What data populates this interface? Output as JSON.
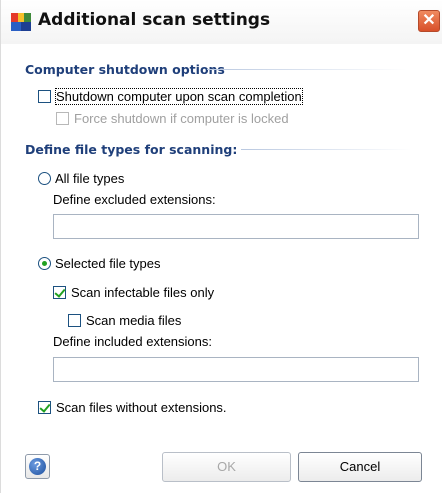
{
  "window": {
    "title": "Additional scan settings",
    "app_icon": "avg-logo-icon",
    "close_glyph": "✕"
  },
  "shutdown_section": {
    "heading": "Computer shutdown options",
    "shutdown_checkbox": {
      "label": "Shutdown computer upon scan completion",
      "checked": false
    },
    "force_checkbox": {
      "label": "Force shutdown if computer is locked",
      "checked": false,
      "disabled": true
    }
  },
  "filetypes_section": {
    "heading": "Define file types for scanning:",
    "all_types_radio": {
      "label": "All file types",
      "selected": false
    },
    "excluded_caption": "Define excluded extensions:",
    "excluded_value": "",
    "selected_types_radio": {
      "label": "Selected file types",
      "selected": true
    },
    "infectable_checkbox": {
      "label": "Scan infectable files only",
      "checked": true
    },
    "media_checkbox": {
      "label": "Scan media files",
      "checked": false
    },
    "included_caption": "Define included extensions:",
    "included_value": "",
    "no_ext_checkbox": {
      "label": "Scan files without extensions.",
      "checked": true
    }
  },
  "footer": {
    "help_icon": "help-icon",
    "help_glyph": "?",
    "ok_label": "OK",
    "ok_enabled": false,
    "cancel_label": "Cancel"
  },
  "colors": {
    "heading": "#1f3f7a",
    "check_mark": "#21a121",
    "close_button": "#d8502a"
  }
}
